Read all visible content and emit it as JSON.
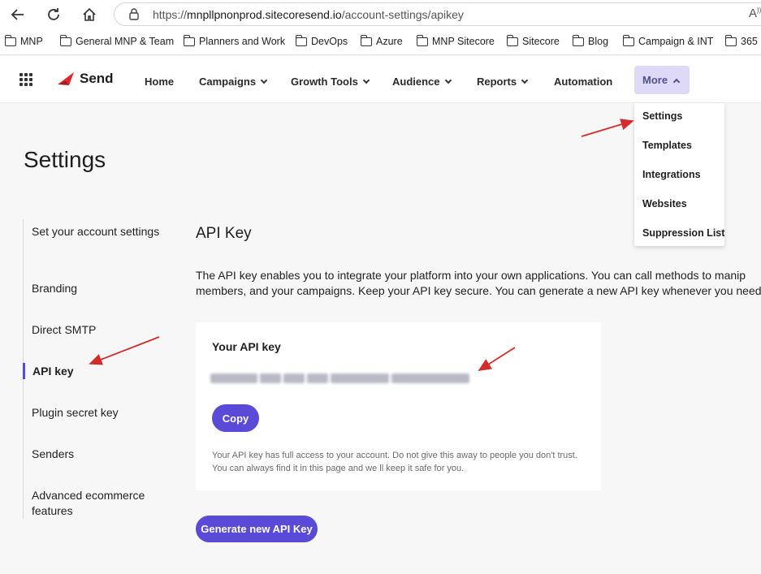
{
  "browser": {
    "url_prefix": "https://",
    "url_host": "mnpllpnonprod.sitecoresend.io",
    "url_path": "/account-settings/apikey",
    "bookmarks": [
      "MNP",
      "General MNP & Team",
      "Planners and Work",
      "DevOps",
      "Azure",
      "MNP Sitecore",
      "Sitecore",
      "Blog",
      "Campaign & INT",
      "365"
    ]
  },
  "app": {
    "logo_text": "Send",
    "nav": [
      "Home",
      "Campaigns",
      "Growth Tools",
      "Audience",
      "Reports",
      "Automation"
    ],
    "more_label": "More",
    "more_menu": [
      "Settings",
      "Templates",
      "Integrations",
      "Websites",
      "Suppression List"
    ]
  },
  "page": {
    "title": "Settings",
    "sidebar": [
      "Set your account settings",
      "Branding",
      "Direct SMTP",
      "API key",
      "Plugin secret key",
      "Senders",
      "Advanced ecommerce features"
    ],
    "active_sidebar": "API key",
    "section_title": "API Key",
    "description_line1": "The API key enables you to integrate your platform into your own applications. You can call methods to manip",
    "description_line2": "members, and your campaigns. Keep your API key secure. You can generate a new API key whenever you need",
    "card_title": "Your API key",
    "copy_label": "Copy",
    "card_note": "Your API key has full access to your account. Do not give this away to people you don't trust. You can always find it in this page and we ll keep it safe for you.",
    "generate_label": "Generate new API Key"
  },
  "colors": {
    "accent": "#5a4ad8",
    "more_bg": "#ddd9f6",
    "arrow": "#d42b2b"
  }
}
